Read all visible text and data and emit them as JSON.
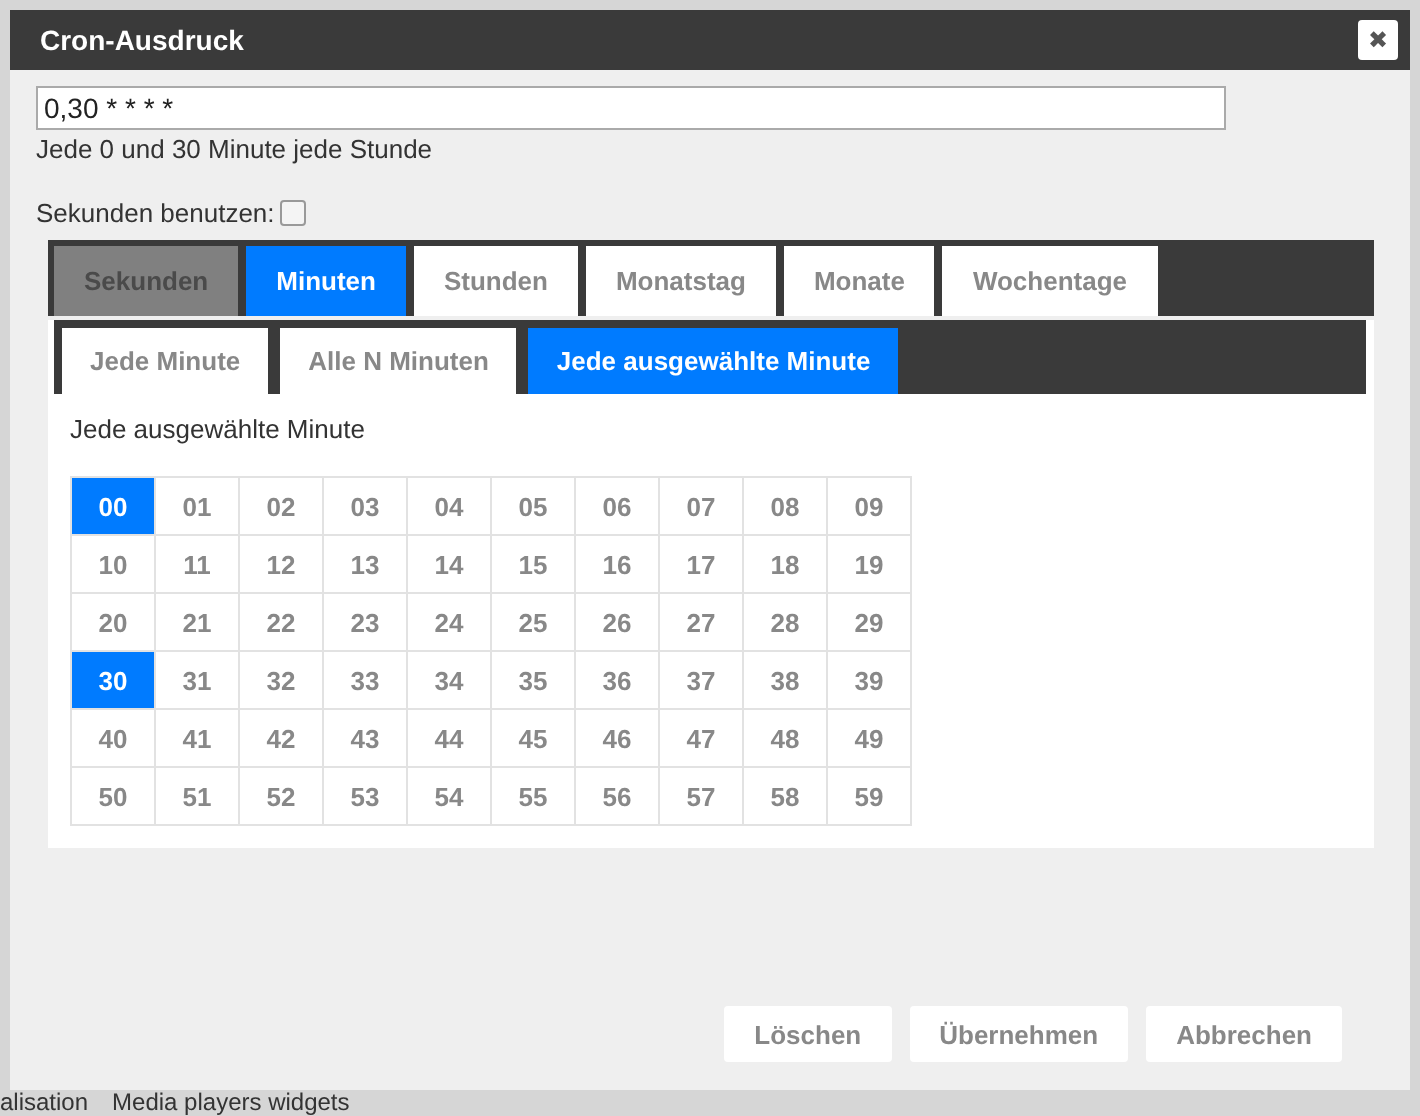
{
  "window": {
    "title": "Cron-Ausdruck",
    "close_label": "✖"
  },
  "expression": {
    "value": "0,30 * * * *"
  },
  "description": "Jede 0 und 30 Minute jede Stunde",
  "use_seconds": {
    "label": "Sekunden benutzen:",
    "checked": false
  },
  "tabs": [
    {
      "label": "Sekunden",
      "selected": false,
      "disabled": true
    },
    {
      "label": "Minuten",
      "selected": true,
      "disabled": false
    },
    {
      "label": "Stunden",
      "selected": false,
      "disabled": false
    },
    {
      "label": "Monatstag",
      "selected": false,
      "disabled": false
    },
    {
      "label": "Monate",
      "selected": false,
      "disabled": false
    },
    {
      "label": "Wochentage",
      "selected": false,
      "disabled": false
    }
  ],
  "subtabs": [
    {
      "label": "Jede Minute",
      "selected": false
    },
    {
      "label": "Alle N Minuten",
      "selected": false
    },
    {
      "label": "Jede ausgewählte Minute",
      "selected": true
    }
  ],
  "panel_heading": "Jede ausgewählte Minute",
  "minutes": [
    {
      "label": "00",
      "selected": true
    },
    {
      "label": "01",
      "selected": false
    },
    {
      "label": "02",
      "selected": false
    },
    {
      "label": "03",
      "selected": false
    },
    {
      "label": "04",
      "selected": false
    },
    {
      "label": "05",
      "selected": false
    },
    {
      "label": "06",
      "selected": false
    },
    {
      "label": "07",
      "selected": false
    },
    {
      "label": "08",
      "selected": false
    },
    {
      "label": "09",
      "selected": false
    },
    {
      "label": "10",
      "selected": false
    },
    {
      "label": "11",
      "selected": false
    },
    {
      "label": "12",
      "selected": false
    },
    {
      "label": "13",
      "selected": false
    },
    {
      "label": "14",
      "selected": false
    },
    {
      "label": "15",
      "selected": false
    },
    {
      "label": "16",
      "selected": false
    },
    {
      "label": "17",
      "selected": false
    },
    {
      "label": "18",
      "selected": false
    },
    {
      "label": "19",
      "selected": false
    },
    {
      "label": "20",
      "selected": false
    },
    {
      "label": "21",
      "selected": false
    },
    {
      "label": "22",
      "selected": false
    },
    {
      "label": "23",
      "selected": false
    },
    {
      "label": "24",
      "selected": false
    },
    {
      "label": "25",
      "selected": false
    },
    {
      "label": "26",
      "selected": false
    },
    {
      "label": "27",
      "selected": false
    },
    {
      "label": "28",
      "selected": false
    },
    {
      "label": "29",
      "selected": false
    },
    {
      "label": "30",
      "selected": true
    },
    {
      "label": "31",
      "selected": false
    },
    {
      "label": "32",
      "selected": false
    },
    {
      "label": "33",
      "selected": false
    },
    {
      "label": "34",
      "selected": false
    },
    {
      "label": "35",
      "selected": false
    },
    {
      "label": "36",
      "selected": false
    },
    {
      "label": "37",
      "selected": false
    },
    {
      "label": "38",
      "selected": false
    },
    {
      "label": "39",
      "selected": false
    },
    {
      "label": "40",
      "selected": false
    },
    {
      "label": "41",
      "selected": false
    },
    {
      "label": "42",
      "selected": false
    },
    {
      "label": "43",
      "selected": false
    },
    {
      "label": "44",
      "selected": false
    },
    {
      "label": "45",
      "selected": false
    },
    {
      "label": "46",
      "selected": false
    },
    {
      "label": "47",
      "selected": false
    },
    {
      "label": "48",
      "selected": false
    },
    {
      "label": "49",
      "selected": false
    },
    {
      "label": "50",
      "selected": false
    },
    {
      "label": "51",
      "selected": false
    },
    {
      "label": "52",
      "selected": false
    },
    {
      "label": "53",
      "selected": false
    },
    {
      "label": "54",
      "selected": false
    },
    {
      "label": "55",
      "selected": false
    },
    {
      "label": "56",
      "selected": false
    },
    {
      "label": "57",
      "selected": false
    },
    {
      "label": "58",
      "selected": false
    },
    {
      "label": "59",
      "selected": false
    }
  ],
  "buttons": [
    "Löschen",
    "Übernehmen",
    "Abbrechen"
  ],
  "background_text": [
    "alisation",
    "Media players widgets"
  ]
}
